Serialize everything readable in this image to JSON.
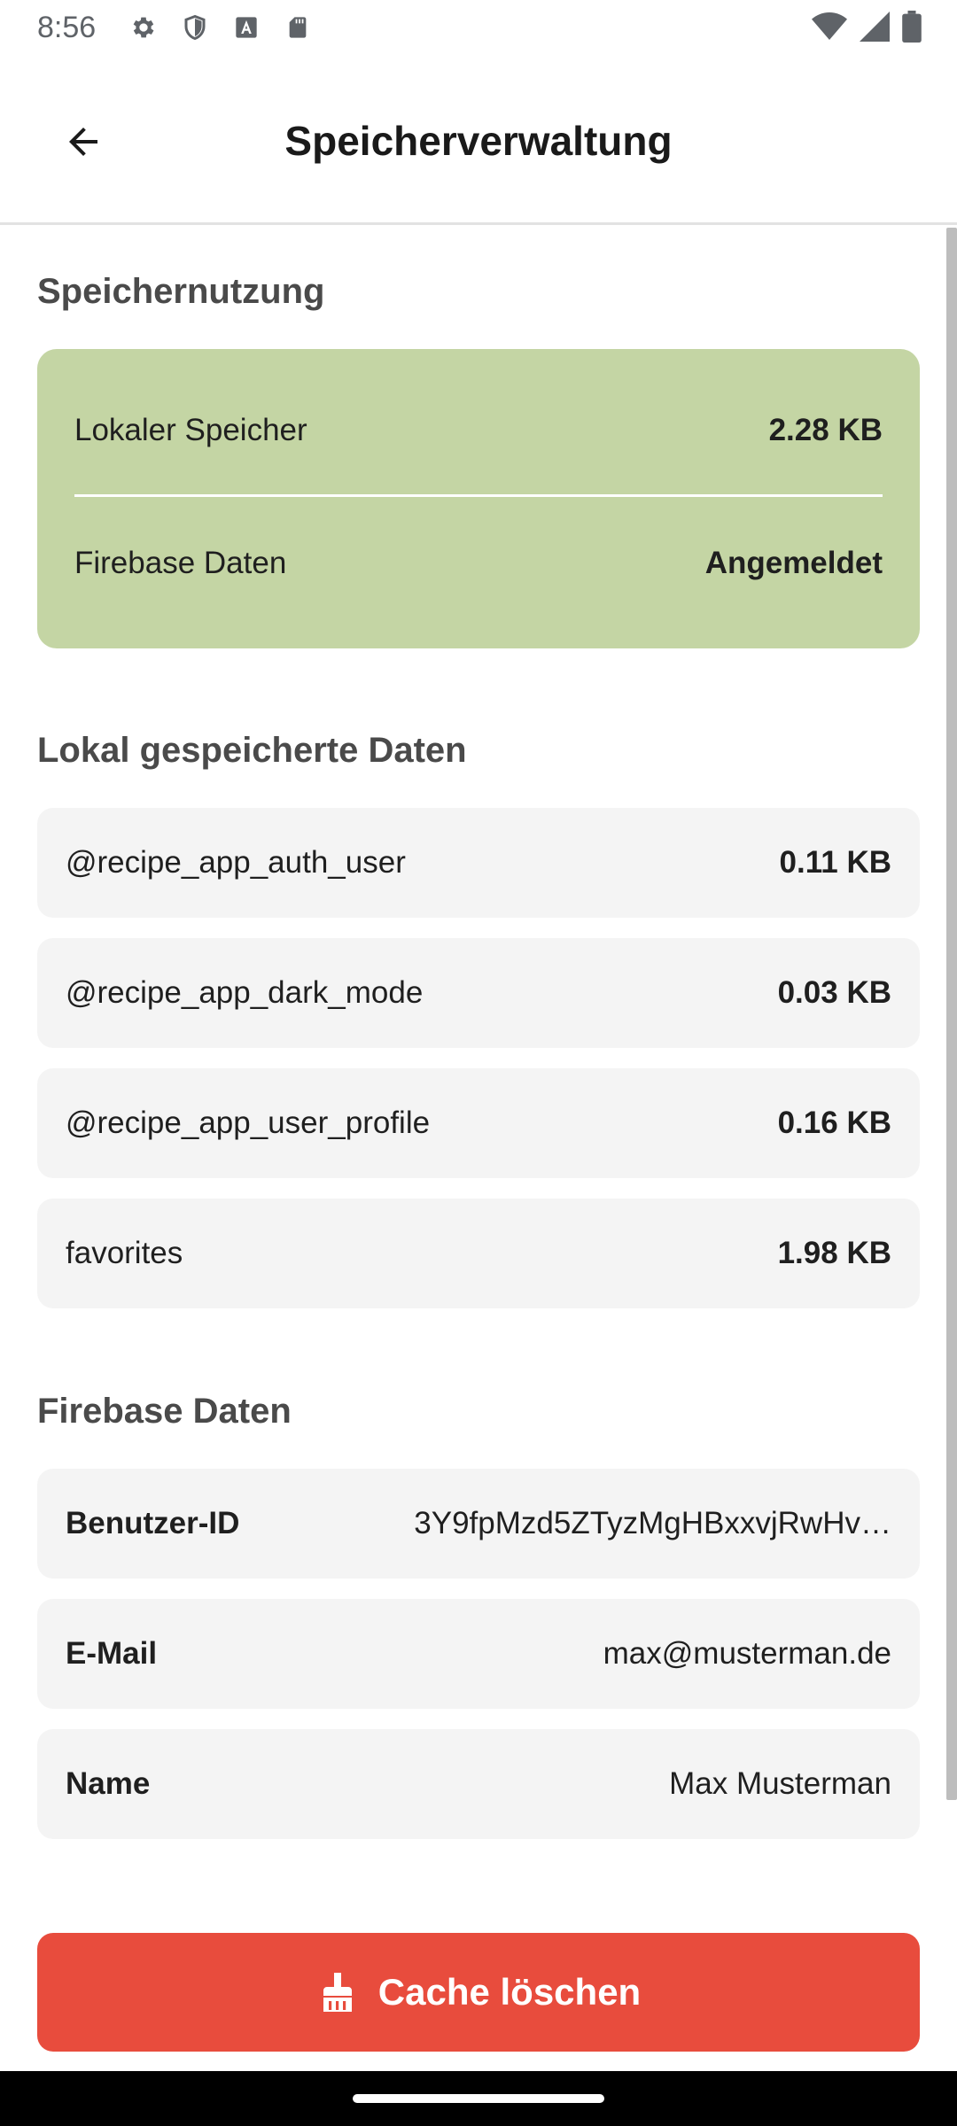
{
  "status_bar": {
    "time": "8:56",
    "icons": [
      "gear-icon",
      "shield-icon",
      "font-icon",
      "sd-card-icon",
      "wifi-icon",
      "signal-icon",
      "battery-icon"
    ]
  },
  "app_bar": {
    "title": "Speicherverwaltung",
    "back_icon": "arrow-left-icon"
  },
  "usage": {
    "section_title": "Speichernutzung",
    "rows": [
      {
        "label": "Lokaler Speicher",
        "value": "2.28 KB"
      },
      {
        "label": "Firebase Daten",
        "value": "Angemeldet"
      }
    ],
    "card_color": "#c4d5a4"
  },
  "local_data": {
    "section_title": "Lokal gespeicherte Daten",
    "items": [
      {
        "key": "@recipe_app_auth_user",
        "size": "0.11 KB"
      },
      {
        "key": "@recipe_app_dark_mode",
        "size": "0.03 KB"
      },
      {
        "key": "@recipe_app_user_profile",
        "size": "0.16 KB"
      },
      {
        "key": "favorites",
        "size": "1.98 KB"
      }
    ]
  },
  "firebase_data": {
    "section_title": "Firebase Daten",
    "items": [
      {
        "label": "Benutzer-ID",
        "value": "3Y9fpMzd5ZTyzMgHBxxvjRwHv…"
      },
      {
        "label": "E-Mail",
        "value": "max@musterman.de"
      },
      {
        "label": "Name",
        "value": "Max Musterman"
      }
    ]
  },
  "actions": {
    "clear_cache_label": "Cache löschen",
    "clear_cache_icon": "broom-icon",
    "button_color": "#e84c3d"
  }
}
